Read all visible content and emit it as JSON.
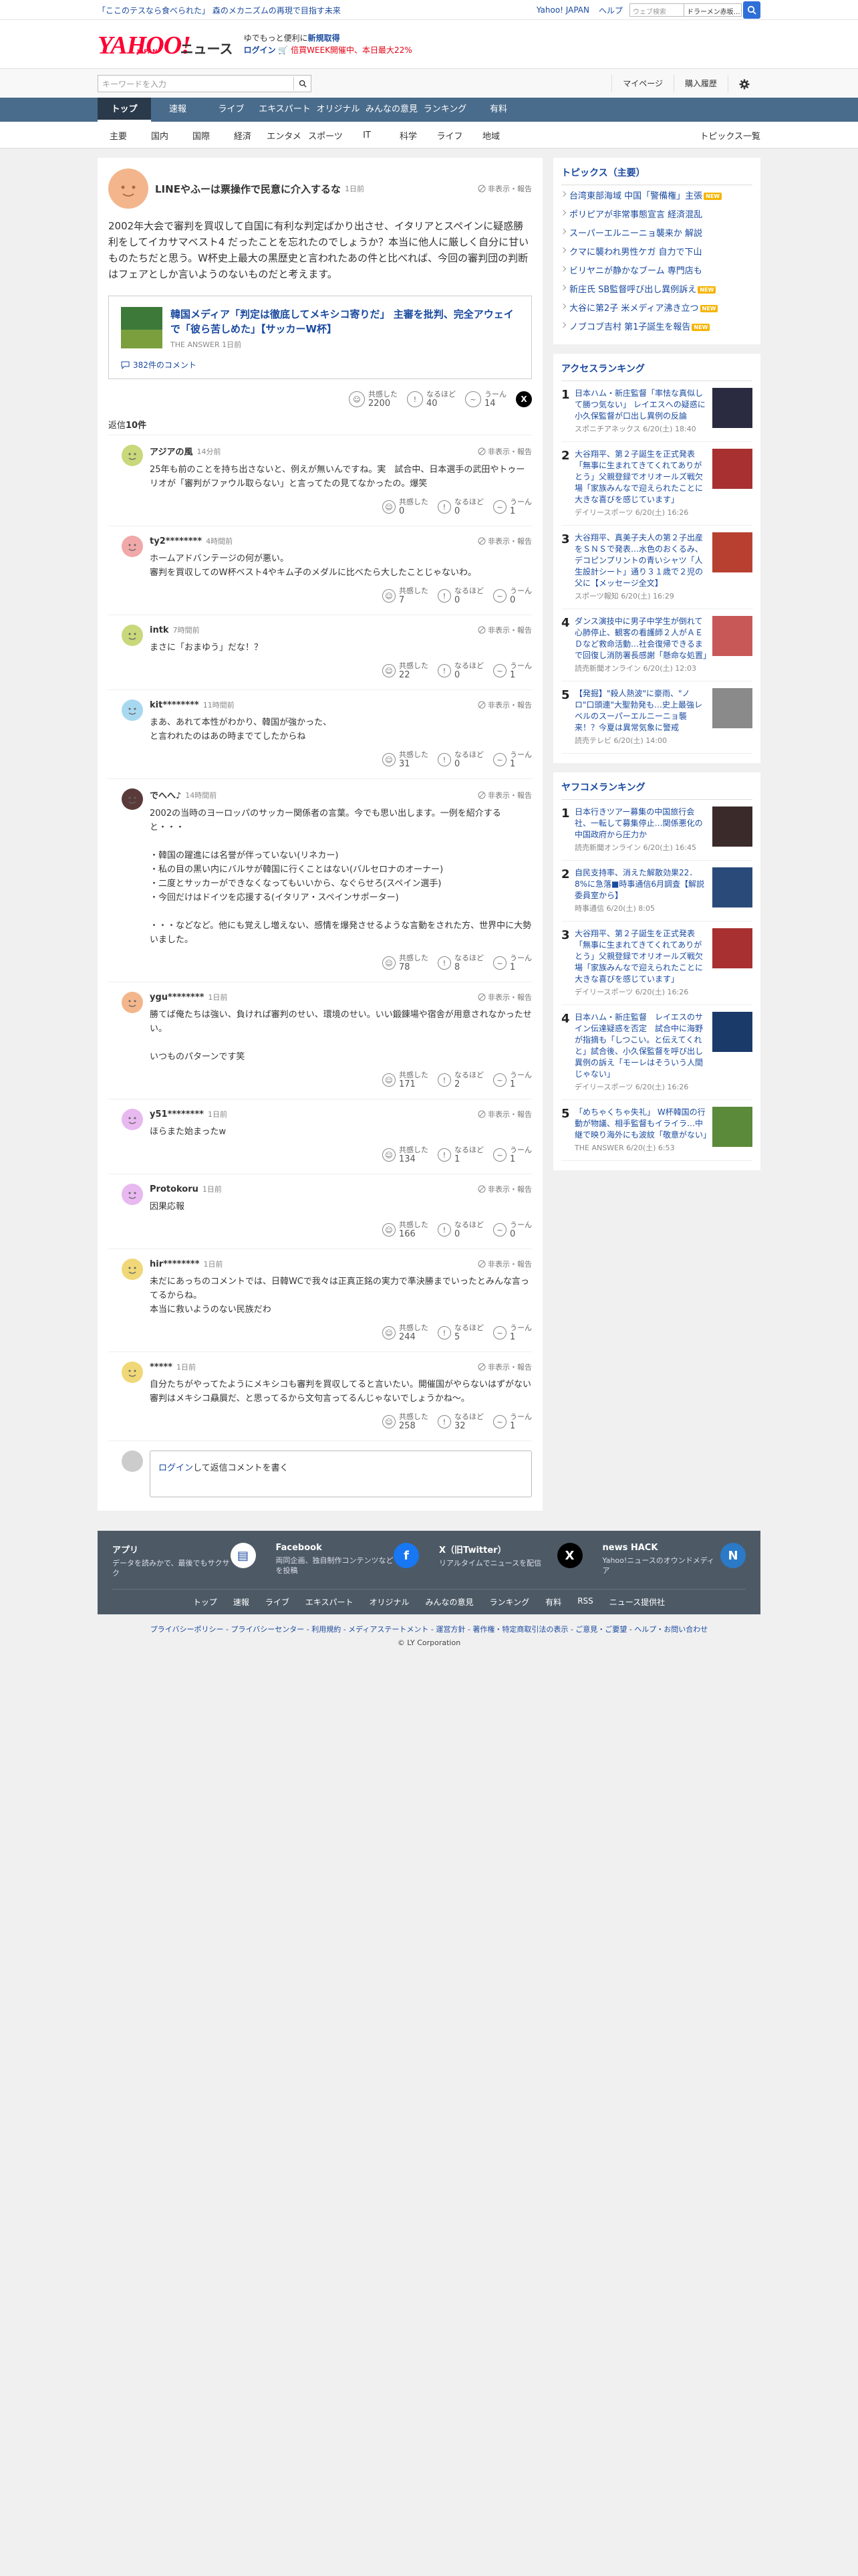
{
  "promo": "「ここのテスなら食べられた」 森のメカニズムの再現で目指す未来",
  "toplinks": [
    "Yahoo! JAPAN",
    "ヘルプ"
  ],
  "websearch": {
    "placeholder": "ウェブ検索",
    "query": "ドラーメン赤坂…"
  },
  "logo": {
    "yahoo": "YAHOO!",
    "japan": "JAPAN",
    "news": "ニュース"
  },
  "header_promo": {
    "line1_pre": "ゆでもっと便利に",
    "line1_bold": "新規取得",
    "login": "ログイン",
    "line2": "🛒 倍買WEEK開催中、本日最大22%"
  },
  "search": {
    "placeholder": "キーワードを入力"
  },
  "header_buttons": [
    "マイページ",
    "購入履歴"
  ],
  "nav": [
    "トップ",
    "速報",
    "ライブ",
    "エキスパート",
    "オリジナル",
    "みんなの意見",
    "ランキング",
    "有料"
  ],
  "subnav": [
    "主要",
    "国内",
    "国際",
    "経済",
    "エンタメ",
    "スポーツ",
    "IT",
    "科学",
    "ライフ",
    "地域"
  ],
  "subnav_right": "トピックス一覧",
  "report_label": "非表示・報告",
  "main_comment": {
    "user": "LINEやふーは票操作で民意に介入するな",
    "time": "1日前",
    "text": "2002年大会で審判を買収して自国に有利な判定ばかり出させ、イタリアとスペインに疑惑勝利をしてイカサマベスト4 だったことを忘れたのでしょうか？本当に他人に厳しく自分に甘いものたちだと思う。W杯史上最大の黒歴史と言われたあの件と比べれば、今回の審判団の判断はフェアとしか言いようのないものだと考えます。",
    "article_title": "韓国メディア「判定は徹底してメキシコ寄りだ」 主審を批判、完全アウェイで「彼ら苦しめた」【サッカーW杯】",
    "article_source": "THE ANSWER 1日前",
    "comments_link": "382件のコメント",
    "agree": "2200",
    "nahodo": "40",
    "uun": "14"
  },
  "react_labels": {
    "agree": "共感した",
    "nahodo": "なるほど",
    "uun": "うーん"
  },
  "reply_count_pre": "返信",
  "reply_count": "10件",
  "replies": [
    {
      "user": "アジアの風",
      "time": "14分前",
      "text": "25年も前のことを持ち出さないと、例えが無いんですね。実　試合中、日本選手の武田やトゥーリオが「審判がファウル取らない」と言ってたの見てなかったの。爆笑",
      "agree": "0",
      "nahodo": "0",
      "uun": "1"
    },
    {
      "user": "ty2********",
      "time": "4時間前",
      "text": "ホームアドバンテージの何が悪い。\n審判を買収してのW杯ベスト4やキム子のメダルに比べたら大したことじゃないわ。",
      "agree": "7",
      "nahodo": "0",
      "uun": "0"
    },
    {
      "user": "intk",
      "time": "7時間前",
      "text": "まさに「おまゆう」だな！？",
      "agree": "22",
      "nahodo": "0",
      "uun": "1"
    },
    {
      "user": "kit********",
      "time": "11時間前",
      "text": "まあ、あれて本性がわかり、韓国が強かった、\nと言われたのはあの時までてしたからね",
      "agree": "31",
      "nahodo": "0",
      "uun": "1"
    },
    {
      "user": "でへへ♪",
      "time": "14時間前",
      "text": "2002の当時のヨーロッパのサッカー関係者の言葉。今でも思い出します。一例を紹介すると・・・\n\n・韓国の躍進には名誉が伴っていない(リネカー)\n・私の目の黒い内にバルサが韓国に行くことはない(バルセロナのオーナー)\n・二度とサッカーができなくなってもいいから、なぐらせろ(スペイン選手)\n・今回だけはドイツを応援する(イタリア・スペインサポーター)\n\n・・・などなど。他にも覚えし増えない、感情を爆発させるような言動をされた方、世界中に大勢いました。",
      "agree": "78",
      "nahodo": "8",
      "uun": "1"
    },
    {
      "user": "ygu********",
      "time": "1日前",
      "text": "勝てば俺たちは強い、負ければ審判のせい、環境のせい。いい鍛錬場や宿舎が用意されなかったせい。\n\nいつものパターンです笑",
      "agree": "171",
      "nahodo": "2",
      "uun": "1"
    },
    {
      "user": "y51********",
      "time": "1日前",
      "text": "ほらまた始まったw",
      "agree": "134",
      "nahodo": "1",
      "uun": "1"
    },
    {
      "user": "Protokoru",
      "time": "1日前",
      "text": "因果応報",
      "agree": "166",
      "nahodo": "0",
      "uun": "0"
    },
    {
      "user": "hir********",
      "time": "1日前",
      "text": "未だにあっちのコメントでは、日韓WCで我々は正真正銘の実力で準決勝までいったとみんな言ってるからね。\n本当に救いようのない民族だわ",
      "agree": "244",
      "nahodo": "5",
      "uun": "1"
    },
    {
      "user": "*****",
      "time": "1日前",
      "text": "自分たちがやってたようにメキシコも審判を買収してると言いたい。開催国がやらないはずがない審判はメキシコ贔屓だ、と思ってるから文句言ってるんじゃないでしょうかね～。",
      "agree": "258",
      "nahodo": "32",
      "uun": "1"
    }
  ],
  "post_box": {
    "login": "ログイン",
    "text": "して返信コメントを書く"
  },
  "topics": {
    "title": "トピックス（主要）",
    "items": [
      {
        "t": "台湾東部海域 中国「警備権」主張",
        "new": true
      },
      {
        "t": "ポリピアが非常事態宣言 経済混乱",
        "new": false
      },
      {
        "t": "スーパーエルニーニョ襲来か 解説",
        "new": false
      },
      {
        "t": "クマに襲われ男性ケガ 自力で下山",
        "new": false
      },
      {
        "t": "ビリヤニが静かなブーム 専門店も",
        "new": false
      },
      {
        "t": "新庄氏 SB監督呼び出し異例訴え",
        "new": true
      },
      {
        "t": "大谷に第2子 米メディア沸き立つ",
        "new": true
      },
      {
        "t": "ノブコブ吉村 第1子誕生を報告",
        "new": true
      }
    ],
    "new_label": "NEW"
  },
  "access": {
    "title": "アクセスランキング",
    "items": [
      {
        "no": "1",
        "t": "日本ハム・新庄監督「率怯な真似して勝つ気ない」 レイエスへの疑惑に小久保監督が口出し異例の反論",
        "src": "スポニチアネックス 6/20(土) 18:40",
        "img": "#2a2a40"
      },
      {
        "no": "2",
        "t": "大谷翔平、第２子誕生を正式発表「無事に生まれてきてくれてありがとう」父親登録でオリオールズ戦欠場「家族みんなで迎えられたことに大きな喜びを感じています」",
        "src": "デイリースポーツ 6/20(土) 16:26",
        "img": "#a83030"
      },
      {
        "no": "3",
        "t": "大谷翔平、真美子夫人の第２子出産をＳＮＳで発表…水色のおくるみ、デコピンプリントの青いシャツ「人生設計シート」通り３１歳で２児の父に【メッセージ全文】",
        "src": "スポーツ報知 6/20(土) 16:29",
        "img": "#b84030"
      },
      {
        "no": "4",
        "t": "ダンス演技中に男子中学生が倒れて心肺停止、観客の看護師２人がＡＥＤなど救命活動…社会復帰できるまで回復し消防署長感謝「懸命な処置」",
        "src": "読売新聞オンライン 6/20(土) 12:03",
        "img": "#c85858"
      },
      {
        "no": "5",
        "t": "【発掘】\"殺人熱波\"に豪雨、\"ノロ\"口頭連\"大聖勃発も…史上最強レベルのスーパーエルニーニョ襲来！？今夏は異常気象に警戒",
        "src": "読売テレビ 6/20(土) 14:00",
        "img": "#8a8a8a"
      }
    ]
  },
  "yafuko": {
    "title": "ヤフコメランキング",
    "items": [
      {
        "no": "1",
        "t": "日本行きツアー募集の中国旅行会社、一転して募集停止…関係悪化の中国政府から圧力か",
        "src": "読売新聞オンライン 6/20(土) 16:45",
        "img": "#3a2a2a"
      },
      {
        "no": "2",
        "t": "自民支持率、消えた解散効果22．8%に急落■時事通信6月調査【解説委員室から】",
        "src": "時事通信 6/20(土) 8:05",
        "img": "#2a4a7a"
      },
      {
        "no": "3",
        "t": "大谷翔平、第２子誕生を正式発表「無事に生まれてきてくれてありがとう」父親登録でオリオールズ戦欠場「家族みんなで迎えられたことに大きな喜びを感じています」",
        "src": "デイリースポーツ 6/20(土) 16:26",
        "img": "#a83030"
      },
      {
        "no": "4",
        "t": "日本ハム・新庄監督　レイエスのサイン伝達疑惑を否定　試合中に海野が指摘も「しつこい。と伝えてくれと」試合後、小久保監督を呼び出し異例の訴え「モーレはそういう人間じゃない」",
        "src": "デイリースポーツ 6/20(土) 16:26",
        "img": "#1a3a6a"
      },
      {
        "no": "5",
        "t": "「めちゃくちゃ失礼」 W杯韓国の行動が物議、相手監督もイライラ…中継で映り海外にも波紋「敬意がない」",
        "src": "THE ANSWER 6/20(土) 6:53",
        "img": "#5a8a3a"
      }
    ]
  },
  "footer": {
    "apps": [
      {
        "name": "アプリ",
        "desc": "データを読みかで、最後でもサクサク",
        "icon": "news-app-icon",
        "color": "#ffffff"
      },
      {
        "name": "Facebook",
        "desc": "両同企画、独自制作コンテンツなどを投稿",
        "icon": "facebook-icon",
        "color": "#1877f2"
      },
      {
        "name": "X（旧Twitter）",
        "desc": "リアルタイムでニュースを配信",
        "icon": "x-icon",
        "color": "#000000"
      },
      {
        "name": "news HACK",
        "desc": "Yahoo!ニュースのオウンドメディア",
        "icon": "newshack-icon",
        "color": "#2a7ac8"
      }
    ],
    "links": [
      "トップ",
      "速報",
      "ライブ",
      "エキスパート",
      "オリジナル",
      "みんなの意見",
      "ランキング",
      "有料",
      "RSS",
      "ニュース提供社"
    ],
    "legal": "プライバシーポリシー - プライバシーセンター - 利用規約 - メディアステートメント - 運営方針 - 著作権・特定商取引法の表示 - ご意見・ご要望 - ヘルプ・お問い合わせ",
    "copyright": "© LY Corporation"
  }
}
